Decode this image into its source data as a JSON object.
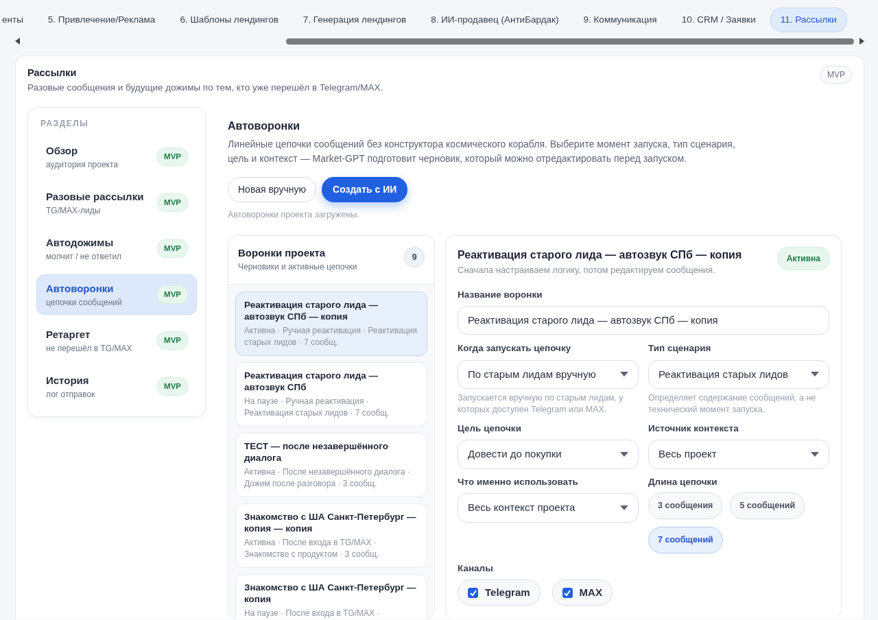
{
  "tabs": [
    {
      "label": "енты",
      "selected": false
    },
    {
      "label": "5. Привлечение/Реклама",
      "selected": false
    },
    {
      "label": "6. Шаблоны лендингов",
      "selected": false
    },
    {
      "label": "7. Генерация лендингов",
      "selected": false
    },
    {
      "label": "8. ИИ-продавец (АнтиБардак)",
      "selected": false
    },
    {
      "label": "9. Коммуникация",
      "selected": false
    },
    {
      "label": "10. CRM / Заявки",
      "selected": false
    },
    {
      "label": "11. Рассылки",
      "selected": true
    }
  ],
  "page": {
    "title": "Рассылки",
    "subtitle": "Разовые сообщения и будущие дожимы по тем, кто уже перешёл в Telegram/MAX.",
    "badge": "MVP"
  },
  "sidebar": {
    "heading": "РАЗДЕЛЫ",
    "items": [
      {
        "title": "Обзор",
        "subtitle": "аудитория проекта",
        "badge": "MVP",
        "selected": false
      },
      {
        "title": "Разовые рассылки",
        "subtitle": "TG/MAX-лиды",
        "badge": "MVP",
        "selected": false
      },
      {
        "title": "Автодожимы",
        "subtitle": "молчит / не ответил",
        "badge": "MVP",
        "selected": false
      },
      {
        "title": "Автоворонки",
        "subtitle": "цепочки сообщений",
        "badge": "MVP",
        "selected": true
      },
      {
        "title": "Ретаргет",
        "subtitle": "не перешёл в TG/MAX",
        "badge": "MVP",
        "selected": false
      },
      {
        "title": "История",
        "subtitle": "лог отправок",
        "badge": "MVP",
        "selected": false
      }
    ]
  },
  "section": {
    "title": "Автоворонки",
    "description": "Линейные цепочки сообщений без конструктора космического корабля. Выберите момент запуска, тип сценария, цель и контекст — Market-GPT подготовит черновик, который можно отредактировать перед запуском.",
    "buttons": [
      {
        "label": "Новая вручную",
        "kind": "secondary"
      },
      {
        "label": "Создать с ИИ",
        "kind": "primary"
      }
    ],
    "status": "Автоворонки проекта загружены."
  },
  "funnels": {
    "title": "Воронки проекта",
    "subtitle": "Черновики и активные цепочки",
    "count": "9",
    "items": [
      {
        "title": "Реактивация старого лида — автозвук СПб — копия",
        "meta": "Активна · Ручная реактивация · Реактивация старых лидов · 7 сообщ.",
        "selected": true
      },
      {
        "title": "Реактивация старого лида — автозвук СПб",
        "meta": "На паузе · Ручная реактивация · Реактивация старых лидов · 7 сообщ.",
        "selected": false
      },
      {
        "title": "ТЕСТ — после незавершённого диалога",
        "meta": "Активна · После незавершённого диалога · Дожим после разговора · 3 сообщ.",
        "selected": false
      },
      {
        "title": "Знакомство с ША Санкт-Петербург — копия — копия",
        "meta": "Активна · После входа в TG/MAX · Знакомство с продуктом · 3 сообщ.",
        "selected": false
      },
      {
        "title": "Знакомство с ША Санкт-Петербург — копия",
        "meta": "На паузе · После входа в TG/MAX ·",
        "selected": false
      }
    ]
  },
  "detail": {
    "title": "Реактивация старого лида — автозвук СПб — копия",
    "subtitle": "Сначала настраиваем логику, потом редактируем сообщения.",
    "status_badge": "Активна",
    "name_label": "Название воронки",
    "name_value": "Реактивация старого лида — автозвук СПб — копия",
    "fields": [
      {
        "kind": "select",
        "label": "Когда запускать цепочку",
        "value": "По старым лидам вручную",
        "hint": "Запускается вручную по старым лидам, у которых доступен Telegram или MAX."
      },
      {
        "kind": "select",
        "label": "Тип сценария",
        "value": "Реактивация старых лидов",
        "hint": "Определяет содержание сообщений, а не технический момент запуска."
      },
      {
        "kind": "select",
        "label": "Цель цепочки",
        "value": "Довести до покупки"
      },
      {
        "kind": "select",
        "label": "Источник контекста",
        "value": "Весь проект"
      },
      {
        "kind": "select",
        "label": "Что именно использовать",
        "value": "Весь контекст проекта"
      },
      {
        "kind": "chips",
        "label": "Длина цепочки",
        "options": [
          {
            "label": "3 сообщения",
            "selected": false
          },
          {
            "label": "5 сообщений",
            "selected": false
          },
          {
            "label": "7 сообщений",
            "selected": true
          }
        ]
      }
    ],
    "channels_label": "Каналы",
    "channels": [
      {
        "label": "Telegram",
        "checked": true
      },
      {
        "label": "MAX",
        "checked": true
      }
    ]
  }
}
